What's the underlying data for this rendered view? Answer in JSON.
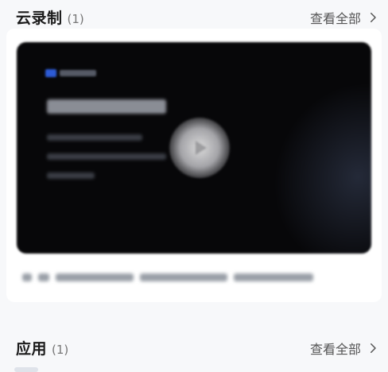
{
  "cloud_recording": {
    "title": "云录制",
    "count": "(1)",
    "view_all": "查看全部"
  },
  "apps": {
    "title": "应用",
    "count": "(1)",
    "view_all": "查看全部"
  },
  "icons": {
    "chevron": "chevron-right-icon",
    "play": "play-icon"
  },
  "colors": {
    "page_background": "#f7f8fa",
    "card_background": "#ffffff",
    "thumbnail_background": "#070709",
    "title_text": "#1b1b1b",
    "secondary_text": "#555555"
  }
}
